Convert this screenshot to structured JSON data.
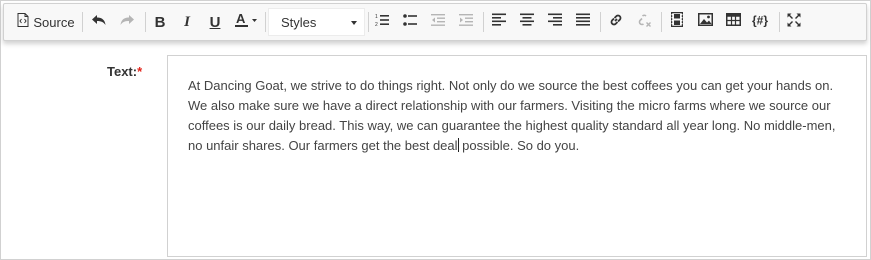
{
  "toolbar": {
    "source_label": "Source",
    "styles_value": "Styles",
    "buttons": [
      {
        "icon": "source-icon"
      },
      {
        "icon": "undo-icon"
      },
      {
        "icon": "redo-icon",
        "disabled": true
      },
      {
        "icon": "bold-icon"
      },
      {
        "icon": "italic-icon"
      },
      {
        "icon": "underline-icon"
      },
      {
        "icon": "text-color-icon"
      },
      {
        "icon": "numbered-list-icon"
      },
      {
        "icon": "bulleted-list-icon"
      },
      {
        "icon": "decrease-indent-icon",
        "disabled": true
      },
      {
        "icon": "increase-indent-icon",
        "disabled": true
      },
      {
        "icon": "align-left-icon"
      },
      {
        "icon": "align-center-icon"
      },
      {
        "icon": "align-right-icon"
      },
      {
        "icon": "justify-icon"
      },
      {
        "icon": "link-icon"
      },
      {
        "icon": "unlink-icon",
        "disabled": true
      },
      {
        "icon": "video-icon"
      },
      {
        "icon": "image-icon"
      },
      {
        "icon": "table-icon"
      },
      {
        "icon": "macro-icon"
      },
      {
        "icon": "maximize-icon"
      }
    ]
  },
  "field": {
    "label": "Text:",
    "required_mark": "*",
    "content_before_cursor": "At Dancing Goat, we strive to do things right. Not only do we source the best coffees you can get your hands on. We also make sure we have a direct relationship with our farmers. Visiting the micro farms where we source our coffees is our daily bread. This way, we can guarantee the highest quality standard all year long. No middle-men, no unfair shares. Our farmers get the best deal",
    "content_after_cursor": " possible. So do you."
  }
}
